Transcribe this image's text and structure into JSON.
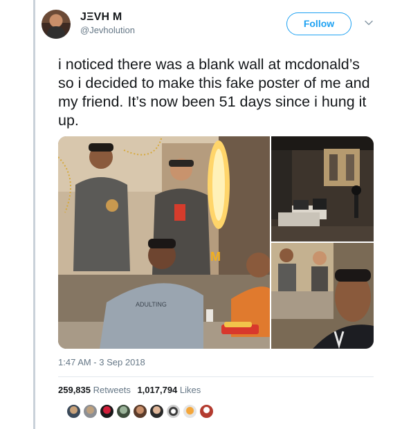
{
  "user": {
    "display_name": "JΞVH M",
    "handle": "@Jevholution"
  },
  "follow_button": {
    "label": "Follow"
  },
  "tweet": {
    "text": "i noticed there was a blank wall at mcdonald’s so i decided to make this fake poster of me and my friend. It’s now been 51 days since i hung it up.",
    "timestamp": "1:47 AM - 3 Sep 2018"
  },
  "stats": {
    "retweets_count": "259,835",
    "retweets_label": "Retweets",
    "likes_count": "1,017,794",
    "likes_label": "Likes"
  },
  "media": {
    "shirt_text": "ADULTING"
  },
  "colors": {
    "accent": "#1da1f2",
    "text": "#14171a",
    "muted": "#657786",
    "divider": "#e1e8ed"
  },
  "icons": {
    "dropdown": "chevron-down-icon"
  }
}
